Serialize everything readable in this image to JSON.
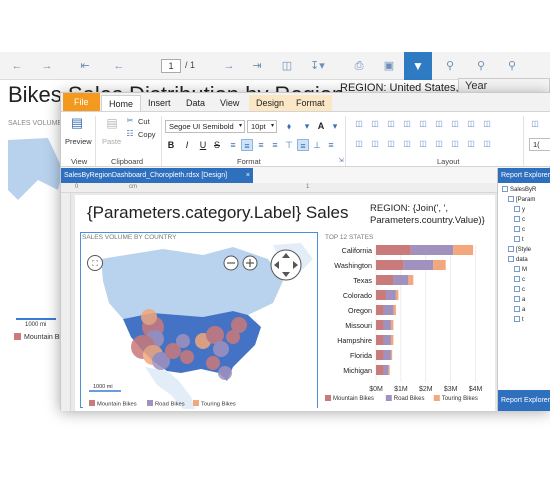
{
  "viewer": {
    "page_current": "1",
    "page_total": "/ 1",
    "title": "Bikes Sales Distribution by Region",
    "region": "REGION: United States, Can",
    "year_label": "Year",
    "sales_volume": "SALES VOLUME BY COUNTRY",
    "scale": "1000 mi",
    "legend_first": "Mountain Bikes"
  },
  "ribbon": {
    "tabs": [
      "File",
      "Home",
      "Insert",
      "Data",
      "View",
      "Design",
      "Format"
    ],
    "preview": "Preview",
    "paste": "Paste",
    "cut": "Cut",
    "copy": "Copy",
    "font_name": "Segoe UI Semibold",
    "font_size": "10pt",
    "group_view": "View",
    "group_clipboard": "Clipboard",
    "group_format": "Format",
    "group_layout": "Layout",
    "right_value": "1("
  },
  "document_tab": "SalesByRegionDashboard_Choropleth.rdsx [Design]",
  "ruler": {
    "zero": "0",
    "cm": "cm",
    "one": "1"
  },
  "report": {
    "title": "{Parameters.category.Label} Sales",
    "region_line1": "REGION: {Join(', ',",
    "region_line2": "Parameters.country.Value)}",
    "map_title": "SALES VOLUME BY COUNTRY",
    "map_scale": "1000 mi",
    "chart_title": "TOP 12 STATES"
  },
  "chart_data": {
    "type": "bar",
    "stacked": true,
    "orientation": "horizontal",
    "title": "TOP 12 STATES",
    "categories": [
      "California",
      "Washington",
      "Texas",
      "Colorado",
      "Oregon",
      "Missouri",
      "Hampshire",
      "Florida",
      "Michigan"
    ],
    "series": [
      {
        "name": "Mountain Bikes",
        "color": "#c97a7a",
        "values": [
          1.4,
          1.1,
          0.7,
          0.4,
          0.3,
          0.3,
          0.3,
          0.3,
          0.3
        ]
      },
      {
        "name": "Road Bikes",
        "color": "#a191bf",
        "values": [
          1.7,
          1.2,
          0.6,
          0.4,
          0.4,
          0.3,
          0.3,
          0.3,
          0.2
        ]
      },
      {
        "name": "Touring Bikes",
        "color": "#f2a77c",
        "values": [
          0.8,
          0.5,
          0.2,
          0.1,
          0.1,
          0.1,
          0.1,
          0.05,
          0.05
        ]
      }
    ],
    "xticks": [
      "$0M",
      "$1M",
      "$2M",
      "$3M",
      "$4M"
    ],
    "xlim": [
      0,
      4.5
    ],
    "grid": true,
    "legend_position": "bottom"
  },
  "map_legend": [
    "Mountain Bikes",
    "Road Bikes",
    "Touring Bikes"
  ],
  "explorer": {
    "header": "Report Explorer",
    "footer": "Report Explorer",
    "items": [
      "SalesByR",
      "[Param",
      "y",
      "c",
      "c",
      "t",
      "[Style",
      "data",
      "M",
      "c",
      "c",
      "a",
      "a",
      "t"
    ]
  }
}
